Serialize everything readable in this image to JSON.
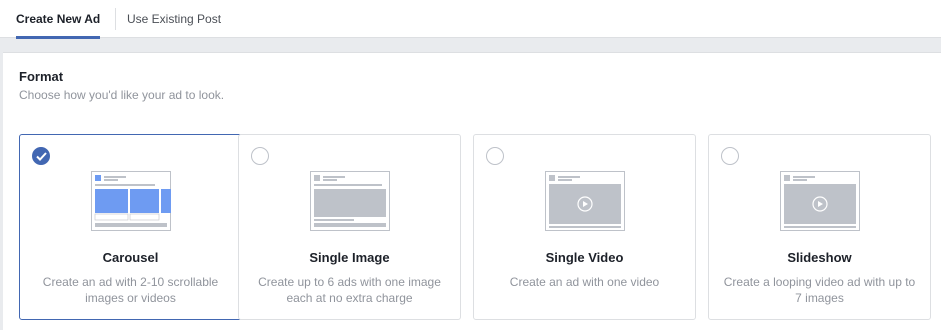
{
  "tabs": [
    {
      "label": "Create New Ad",
      "active": true
    },
    {
      "label": "Use Existing Post",
      "active": false
    }
  ],
  "format": {
    "title": "Format",
    "subtitle": "Choose how you'd like your ad to look.",
    "options": [
      {
        "name": "Carousel",
        "description": "Create an ad with 2-10 scrollable images or videos",
        "selected": true,
        "icon": "carousel-preview-icon"
      },
      {
        "name": "Single Image",
        "description": "Create up to 6 ads with one image each at no extra charge",
        "selected": false,
        "icon": "single-image-preview-icon"
      },
      {
        "name": "Single Video",
        "description": "Create an ad with one video",
        "selected": false,
        "icon": "single-video-preview-icon"
      },
      {
        "name": "Slideshow",
        "description": "Create a looping video ad with up to 7 images",
        "selected": false,
        "icon": "slideshow-preview-icon"
      }
    ]
  },
  "colors": {
    "accent": "#4267b2",
    "carousel_tile": "#6e9bf2",
    "placeholder_gray": "#bec2c9",
    "border": "#dddfe2",
    "muted_text": "#90949c"
  }
}
